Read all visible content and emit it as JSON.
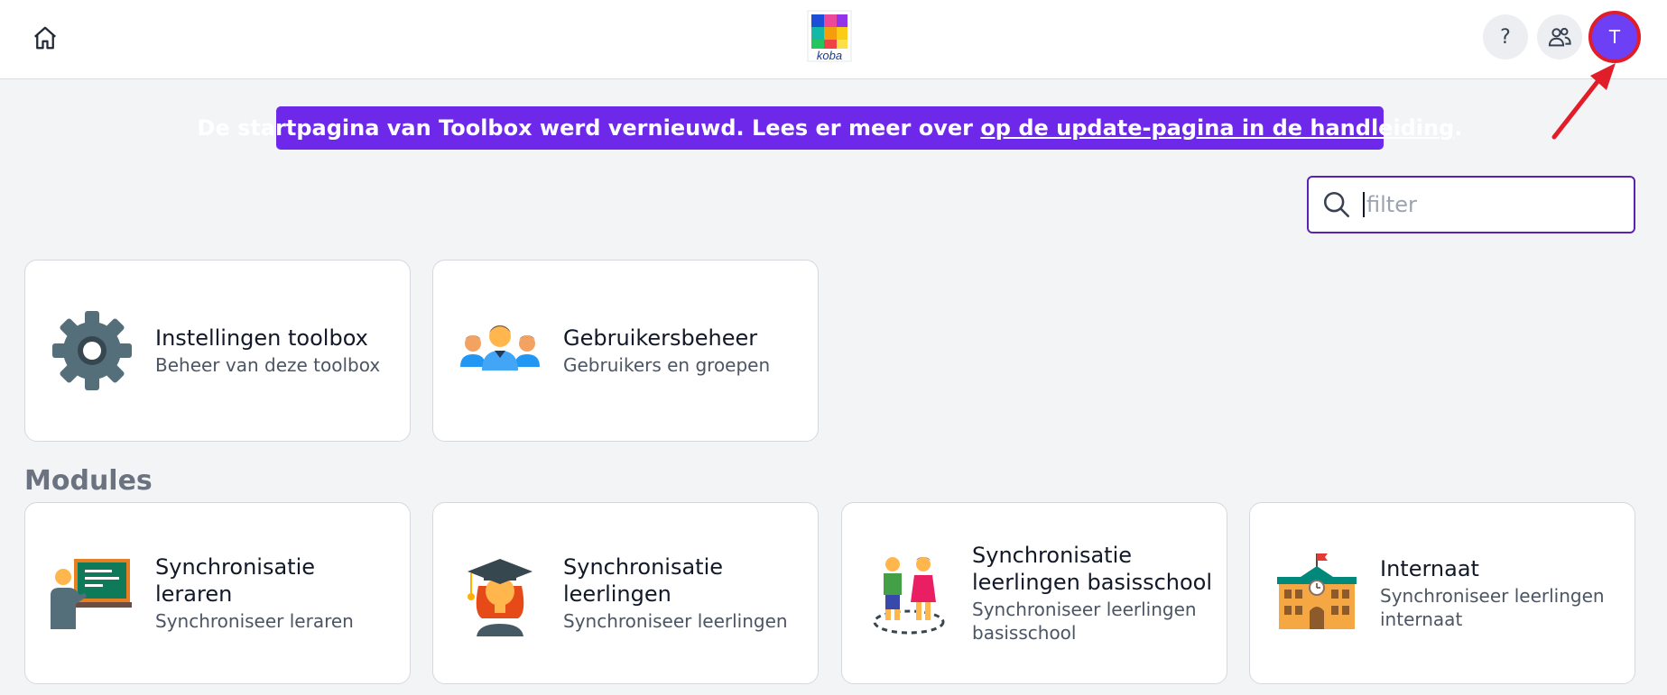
{
  "header": {
    "home_icon": "home-icon",
    "logo_text": "koba",
    "help_label": "?",
    "users_icon": "users-icon",
    "avatar_initial": "T"
  },
  "banner": {
    "text": "De startpagina van Toolbox werd vernieuwd. Lees er meer over ",
    "link_text": "op de update-pagina in de handleiding",
    "suffix": "."
  },
  "search": {
    "placeholder": "filter",
    "value": "",
    "icon": "search-icon"
  },
  "admin_cards": [
    {
      "title": "Instellingen toolbox",
      "subtitle": "Beheer van deze toolbox",
      "icon": "gear-icon"
    },
    {
      "title": "Gebruikersbeheer",
      "subtitle": "Gebruikers en groepen",
      "icon": "group-icon"
    }
  ],
  "modules": {
    "heading": "Modules",
    "cards": [
      {
        "title": "Synchronisatie leraren",
        "subtitle": "Synchroniseer leraren",
        "icon": "teacher-icon"
      },
      {
        "title": "Synchronisatie leerlingen",
        "subtitle": "Synchroniseer leerlingen",
        "icon": "graduate-icon"
      },
      {
        "title": "Synchronisatie leerlingen basisschool",
        "subtitle": "Synchroniseer leerlingen basisschool",
        "icon": "children-icon"
      },
      {
        "title": "Internaat",
        "subtitle": "Synchroniseer leerlingen internaat",
        "icon": "school-building-icon"
      }
    ]
  },
  "colors": {
    "accent": "#6d28e9",
    "avatar": "#6d3ff5",
    "annotation": "#e11d2a"
  }
}
